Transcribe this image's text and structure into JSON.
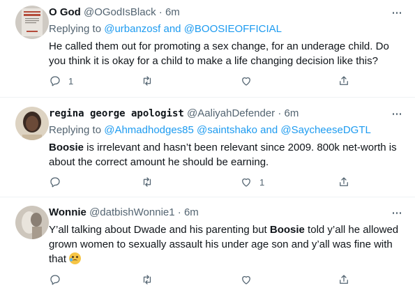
{
  "tweets": [
    {
      "name": "O God",
      "handle": "@OGodIsBlack",
      "dot": "·",
      "time": "6m",
      "reply_prefix": "Replying to",
      "mentions": [
        "@urbanzosf",
        "@BOOSIEOFFICIAL"
      ],
      "reply_joiner": "and",
      "text": "He called them out for promoting a sex change, for an underage child. Do you think it is okay for a child to make a life changing decision like this?",
      "counts": {
        "replies": "1",
        "retweets": "",
        "likes": ""
      },
      "avatar": {
        "bg": "#c9c4bd",
        "accent": "#b44b3a",
        "caption": "THE DELECTABLE NEGRO"
      }
    },
    {
      "name": "regina george apologist",
      "handle": "@AaliyahDefender",
      "dot": "·",
      "time": "6m",
      "reply_prefix": "Replying to",
      "mentions": [
        "@Ahmadhodges85",
        "@saintshako",
        "@SaycheeseDGTL"
      ],
      "reply_joiner": "and",
      "text_bold": "Boosie",
      "text_rest": " is irrelevant and hasn’t been relevant since 2009. 800k net-worth is about the correct amount he should be earning.",
      "counts": {
        "replies": "",
        "retweets": "",
        "likes": "1"
      },
      "avatar": {
        "bg": "#d9d0bf",
        "accent": "#3b2a22"
      }
    },
    {
      "name": "Wonnie",
      "handle": "@datbishWonnie1",
      "dot": "·",
      "time": "6m",
      "text_before": "Y’all talking about Dwade and his parenting but ",
      "text_bold": "Boosie",
      "text_after": " told y’all he allowed grown women to sexually assault his under age son and y’all was fine with that",
      "emoji": "crying-face-emoji",
      "counts": {
        "replies": "",
        "retweets": "",
        "likes": ""
      },
      "avatar": {
        "bg": "#c8c2b9",
        "accent": "#8a7f74"
      }
    }
  ],
  "colors": {
    "text": "#0f1419",
    "muted": "#536471",
    "link": "#1d9bf0",
    "divider": "#eff3f4"
  },
  "icons": [
    "reply-icon",
    "retweet-icon",
    "like-icon",
    "share-icon",
    "more-icon"
  ]
}
